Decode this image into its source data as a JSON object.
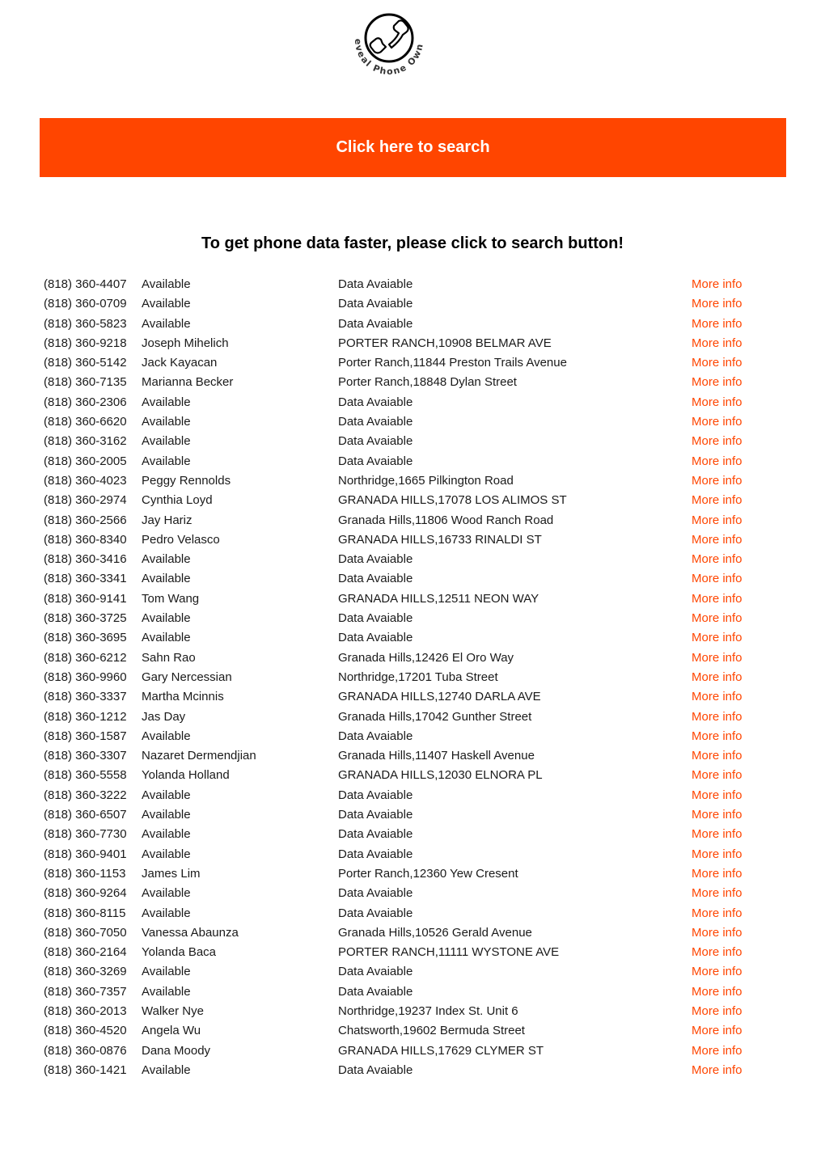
{
  "logo": {
    "icon": "phone-handset-icon",
    "text": "Reveal Phone Owner"
  },
  "banner": {
    "label": "Click here to search",
    "color": "#ff4500"
  },
  "heading": "To get phone data faster, please click to search button!",
  "accent_color": "#ff4500",
  "rows": [
    {
      "phone": "(818) 360-4407",
      "name": "Available",
      "address": "Data Avaiable",
      "link": "More info"
    },
    {
      "phone": "(818) 360-0709",
      "name": "Available",
      "address": "Data Avaiable",
      "link": "More info"
    },
    {
      "phone": "(818) 360-5823",
      "name": "Available",
      "address": "Data Avaiable",
      "link": "More info"
    },
    {
      "phone": "(818) 360-9218",
      "name": "Joseph Mihelich",
      "address": "PORTER RANCH,10908 BELMAR AVE",
      "link": "More info"
    },
    {
      "phone": "(818) 360-5142",
      "name": "Jack Kayacan",
      "address": "Porter Ranch,11844 Preston Trails Avenue",
      "link": "More info"
    },
    {
      "phone": "(818) 360-7135",
      "name": "Marianna Becker",
      "address": "Porter Ranch,18848 Dylan Street",
      "link": "More info"
    },
    {
      "phone": "(818) 360-2306",
      "name": "Available",
      "address": "Data Avaiable",
      "link": "More info"
    },
    {
      "phone": "(818) 360-6620",
      "name": "Available",
      "address": "Data Avaiable",
      "link": "More info"
    },
    {
      "phone": "(818) 360-3162",
      "name": "Available",
      "address": "Data Avaiable",
      "link": "More info"
    },
    {
      "phone": "(818) 360-2005",
      "name": "Available",
      "address": "Data Avaiable",
      "link": "More info"
    },
    {
      "phone": "(818) 360-4023",
      "name": "Peggy Rennolds",
      "address": "Northridge,1665 Pilkington Road",
      "link": "More info"
    },
    {
      "phone": "(818) 360-2974",
      "name": "Cynthia Loyd",
      "address": "GRANADA HILLS,17078 LOS ALIMOS ST",
      "link": "More info"
    },
    {
      "phone": "(818) 360-2566",
      "name": "Jay Hariz",
      "address": "Granada Hills,11806 Wood Ranch Road",
      "link": "More info"
    },
    {
      "phone": "(818) 360-8340",
      "name": "Pedro Velasco",
      "address": "GRANADA HILLS,16733 RINALDI ST",
      "link": "More info"
    },
    {
      "phone": "(818) 360-3416",
      "name": "Available",
      "address": "Data Avaiable",
      "link": "More info"
    },
    {
      "phone": "(818) 360-3341",
      "name": "Available",
      "address": "Data Avaiable",
      "link": "More info"
    },
    {
      "phone": "(818) 360-9141",
      "name": "Tom Wang",
      "address": "GRANADA HILLS,12511 NEON WAY",
      "link": "More info"
    },
    {
      "phone": "(818) 360-3725",
      "name": "Available",
      "address": "Data Avaiable",
      "link": "More info"
    },
    {
      "phone": "(818) 360-3695",
      "name": "Available",
      "address": "Data Avaiable",
      "link": "More info"
    },
    {
      "phone": "(818) 360-6212",
      "name": "Sahn Rao",
      "address": "Granada Hills,12426 El Oro Way",
      "link": "More info"
    },
    {
      "phone": "(818) 360-9960",
      "name": "Gary Nercessian",
      "address": "Northridge,17201 Tuba Street",
      "link": "More info"
    },
    {
      "phone": "(818) 360-3337",
      "name": "Martha Mcinnis",
      "address": "GRANADA HILLS,12740 DARLA AVE",
      "link": "More info"
    },
    {
      "phone": "(818) 360-1212",
      "name": "Jas Day",
      "address": "Granada Hills,17042 Gunther Street",
      "link": "More info"
    },
    {
      "phone": "(818) 360-1587",
      "name": "Available",
      "address": "Data Avaiable",
      "link": "More info"
    },
    {
      "phone": "(818) 360-3307",
      "name": "Nazaret Dermendjian",
      "address": "Granada Hills,11407 Haskell Avenue",
      "link": "More info"
    },
    {
      "phone": "(818) 360-5558",
      "name": "Yolanda Holland",
      "address": "GRANADA HILLS,12030 ELNORA PL",
      "link": "More info"
    },
    {
      "phone": "(818) 360-3222",
      "name": "Available",
      "address": "Data Avaiable",
      "link": "More info"
    },
    {
      "phone": "(818) 360-6507",
      "name": "Available",
      "address": "Data Avaiable",
      "link": "More info"
    },
    {
      "phone": "(818) 360-7730",
      "name": "Available",
      "address": "Data Avaiable",
      "link": "More info"
    },
    {
      "phone": "(818) 360-9401",
      "name": "Available",
      "address": "Data Avaiable",
      "link": "More info"
    },
    {
      "phone": "(818) 360-1153",
      "name": "James Lim",
      "address": "Porter Ranch,12360 Yew Cresent",
      "link": "More info"
    },
    {
      "phone": "(818) 360-9264",
      "name": "Available",
      "address": "Data Avaiable",
      "link": "More info"
    },
    {
      "phone": "(818) 360-8115",
      "name": "Available",
      "address": "Data Avaiable",
      "link": "More info"
    },
    {
      "phone": "(818) 360-7050",
      "name": "Vanessa Abaunza",
      "address": "Granada Hills,10526 Gerald Avenue",
      "link": "More info"
    },
    {
      "phone": "(818) 360-2164",
      "name": "Yolanda Baca",
      "address": "PORTER RANCH,11111 WYSTONE AVE",
      "link": "More info"
    },
    {
      "phone": "(818) 360-3269",
      "name": "Available",
      "address": "Data Avaiable",
      "link": "More info"
    },
    {
      "phone": "(818) 360-7357",
      "name": "Available",
      "address": "Data Avaiable",
      "link": "More info"
    },
    {
      "phone": "(818) 360-2013",
      "name": "Walker Nye",
      "address": "Northridge,19237 Index St. Unit 6",
      "link": "More info"
    },
    {
      "phone": "(818) 360-4520",
      "name": "Angela Wu",
      "address": "Chatsworth,19602 Bermuda Street",
      "link": "More info"
    },
    {
      "phone": "(818) 360-0876",
      "name": "Dana Moody",
      "address": "GRANADA HILLS,17629 CLYMER ST",
      "link": "More info"
    },
    {
      "phone": "(818) 360-1421",
      "name": "Available",
      "address": "Data Avaiable",
      "link": "More info"
    }
  ]
}
